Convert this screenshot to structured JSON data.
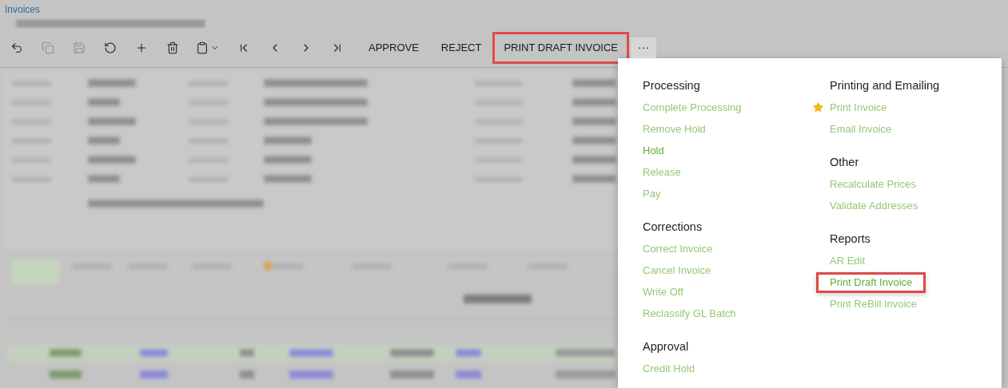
{
  "breadcrumb": "Invoices",
  "toolbar": {
    "icons": [
      {
        "kind": "back",
        "disabled": false
      },
      {
        "kind": "copy",
        "disabled": true
      },
      {
        "kind": "save",
        "disabled": true
      },
      {
        "kind": "undo",
        "disabled": false
      },
      {
        "kind": "add",
        "disabled": false
      },
      {
        "kind": "delete",
        "disabled": false
      },
      {
        "kind": "clipboard",
        "disabled": false
      },
      {
        "kind": "first",
        "disabled": false
      },
      {
        "kind": "previous",
        "disabled": false
      },
      {
        "kind": "next",
        "disabled": false
      },
      {
        "kind": "last",
        "disabled": false
      }
    ],
    "buttons": [
      {
        "label": "APPROVE",
        "highlighted": false
      },
      {
        "label": "REJECT",
        "highlighted": false
      },
      {
        "label": "PRINT DRAFT INVOICE",
        "highlighted": true
      }
    ],
    "more": "···"
  },
  "menu": {
    "columns": [
      [
        {
          "title": "Processing",
          "items": [
            {
              "label": "Complete Processing",
              "enabled": false,
              "favorite": false,
              "highlighted": false
            },
            {
              "label": "Remove Hold",
              "enabled": false,
              "favorite": false,
              "highlighted": false
            },
            {
              "label": "Hold",
              "enabled": true,
              "favorite": false,
              "highlighted": false
            },
            {
              "label": "Release",
              "enabled": false,
              "favorite": false,
              "highlighted": false
            },
            {
              "label": "Pay",
              "enabled": false,
              "favorite": false,
              "highlighted": false
            }
          ]
        },
        {
          "title": "Corrections",
          "items": [
            {
              "label": "Correct Invoice",
              "enabled": false,
              "favorite": false,
              "highlighted": false
            },
            {
              "label": "Cancel Invoice",
              "enabled": false,
              "favorite": false,
              "highlighted": false
            },
            {
              "label": "Write Off",
              "enabled": false,
              "favorite": false,
              "highlighted": false
            },
            {
              "label": "Reclassify GL Batch",
              "enabled": false,
              "favorite": false,
              "highlighted": false
            }
          ]
        },
        {
          "title": "Approval",
          "items": [
            {
              "label": "Credit Hold",
              "enabled": false,
              "favorite": false,
              "highlighted": false
            }
          ]
        }
      ],
      [
        {
          "title": "Printing and Emailing",
          "items": [
            {
              "label": "Print Invoice",
              "enabled": false,
              "favorite": true,
              "highlighted": false
            },
            {
              "label": "Email Invoice",
              "enabled": false,
              "favorite": false,
              "highlighted": false
            }
          ]
        },
        {
          "title": "Other",
          "items": [
            {
              "label": "Recalculate Prices",
              "enabled": false,
              "favorite": false,
              "highlighted": false
            },
            {
              "label": "Validate Addresses",
              "enabled": false,
              "favorite": false,
              "highlighted": false
            }
          ]
        },
        {
          "title": "Reports",
          "items": [
            {
              "label": "AR Edit",
              "enabled": false,
              "favorite": false,
              "highlighted": false
            },
            {
              "label": "Print Draft Invoice",
              "enabled": true,
              "favorite": false,
              "highlighted": true
            },
            {
              "label": "Print ReBill Invoice",
              "enabled": false,
              "favorite": false,
              "highlighted": false
            }
          ]
        }
      ]
    ]
  }
}
